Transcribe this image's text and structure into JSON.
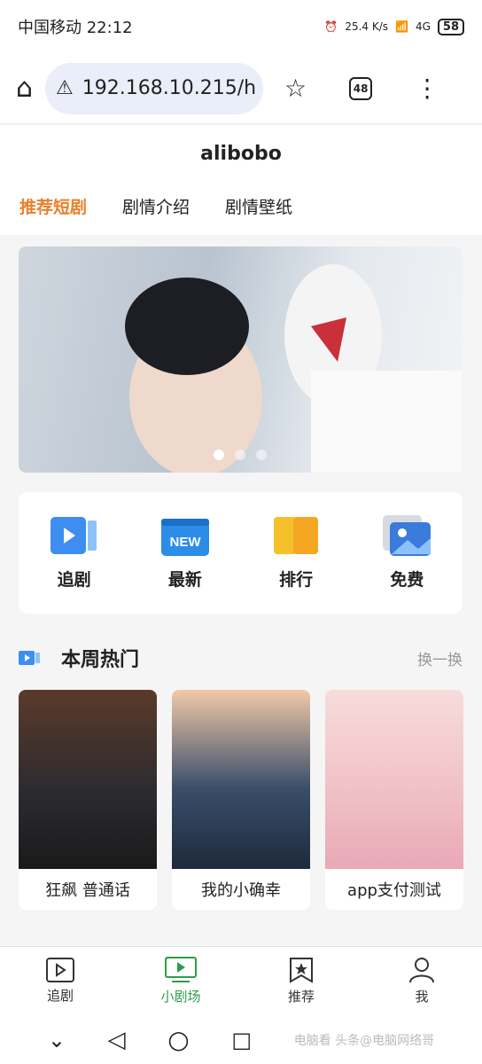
{
  "status": {
    "carrier_time": "中国移动 22:12",
    "net_speed": "25.4 K/s",
    "signal": "4G",
    "battery": "58"
  },
  "browser": {
    "url": "192.168.10.215/h",
    "tab_count": "48"
  },
  "site": {
    "title": "alibobo",
    "tabs": [
      "推荐短剧",
      "剧情介绍",
      "剧情壁纸"
    ]
  },
  "quick": [
    {
      "label": "追剧",
      "icon": "play-card-icon",
      "color": "#3d8ef0"
    },
    {
      "label": "最新",
      "icon": "new-calendar-icon",
      "badge": "NEW",
      "color": "#2b8de6"
    },
    {
      "label": "排行",
      "icon": "ranking-icon",
      "color": "#f5a623"
    },
    {
      "label": "免费",
      "icon": "picture-icon",
      "color": "#3a7bdc"
    }
  ],
  "section": {
    "title": "本周热门",
    "refresh": "换一换"
  },
  "cards": [
    {
      "title": "狂飙 普通话"
    },
    {
      "title": "我的小确幸"
    },
    {
      "title": "app支付测试"
    }
  ],
  "bottom_nav": [
    {
      "label": "追剧",
      "icon": "play-box-icon"
    },
    {
      "label": "小剧场",
      "icon": "monitor-play-icon"
    },
    {
      "label": "推荐",
      "icon": "bookmark-star-icon"
    },
    {
      "label": "我",
      "icon": "person-icon"
    }
  ],
  "watermark": "电脑看 头条@电脑网络哥"
}
